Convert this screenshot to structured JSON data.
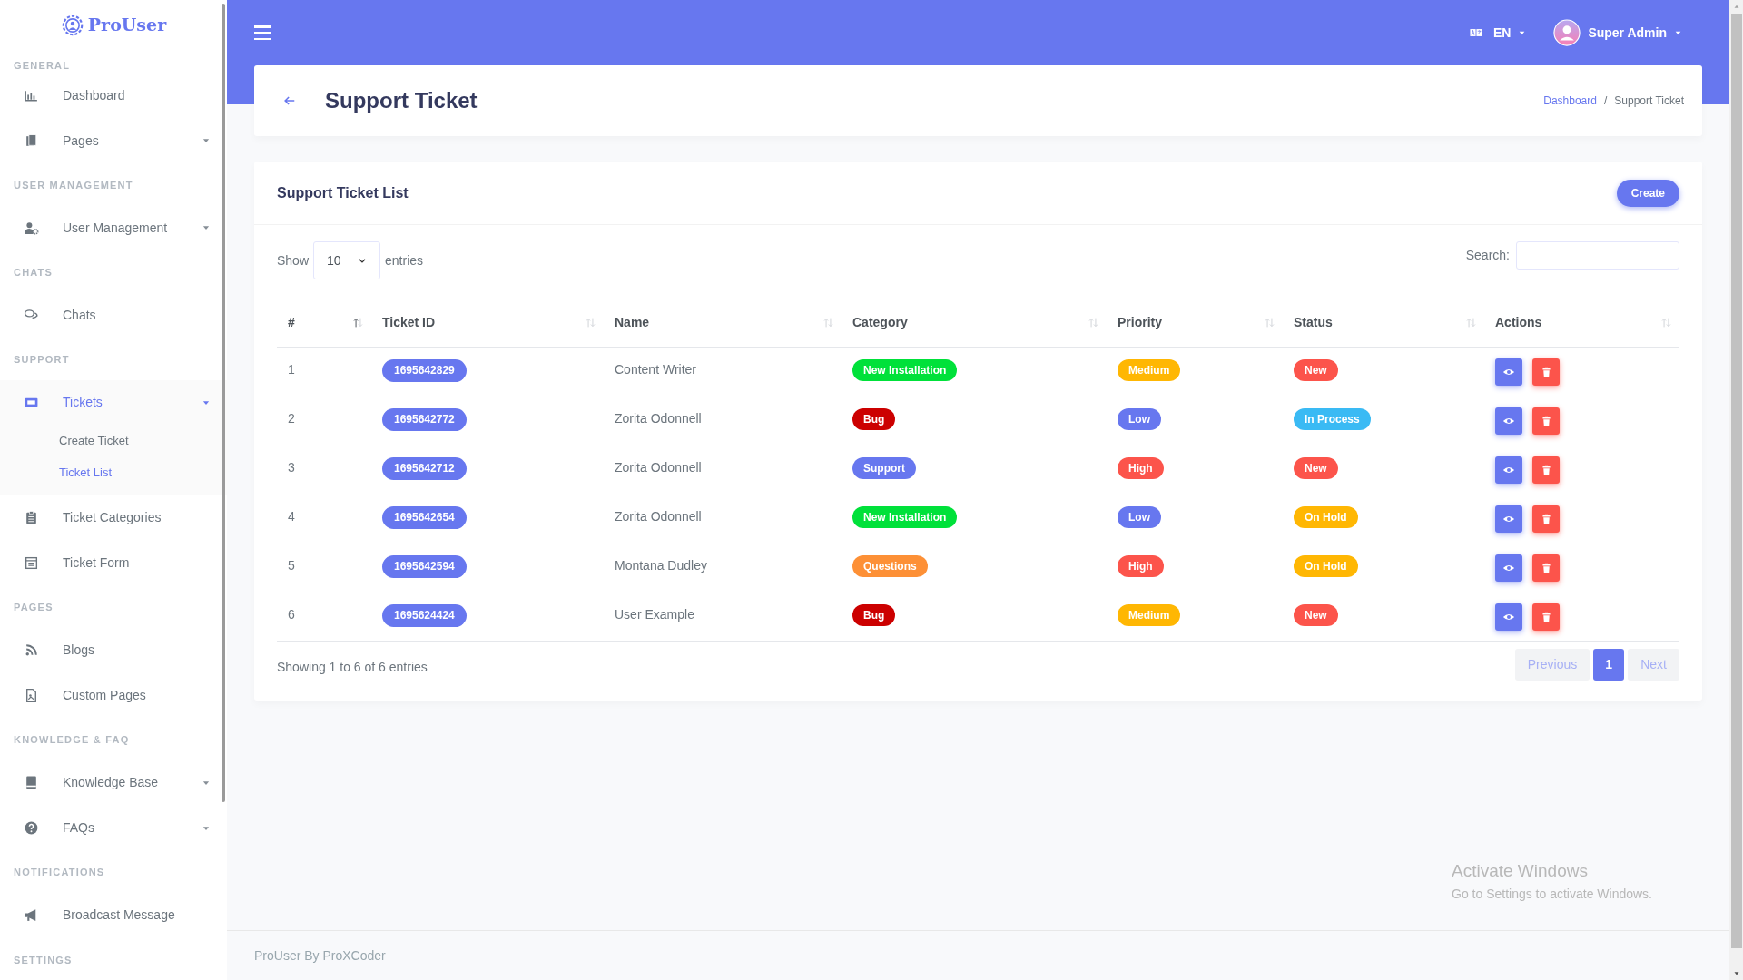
{
  "brand": {
    "name": "ProUser"
  },
  "sidebar": [
    {
      "kind": "header",
      "label": "GENERAL"
    },
    {
      "kind": "item",
      "label": "Dashboard",
      "dropdown": false,
      "selected": false
    },
    {
      "kind": "item",
      "label": "Pages",
      "dropdown": true,
      "selected": false
    },
    {
      "kind": "header",
      "label": "USER MANAGEMENT"
    },
    {
      "kind": "item",
      "label": "User Management",
      "dropdown": true,
      "selected": false
    },
    {
      "kind": "header",
      "label": "CHATS"
    },
    {
      "kind": "item",
      "label": "Chats",
      "dropdown": false,
      "selected": false
    },
    {
      "kind": "header",
      "label": "SUPPORT"
    },
    {
      "kind": "item",
      "label": "Tickets",
      "dropdown": true,
      "selected": true,
      "children": [
        {
          "label": "Create Ticket",
          "selected": false
        },
        {
          "label": "Ticket List",
          "selected": true
        }
      ]
    },
    {
      "kind": "item",
      "label": "Ticket Categories",
      "dropdown": false,
      "selected": false
    },
    {
      "kind": "item",
      "label": "Ticket Form",
      "dropdown": false,
      "selected": false
    },
    {
      "kind": "header",
      "label": "PAGES"
    },
    {
      "kind": "item",
      "label": "Blogs",
      "dropdown": false,
      "selected": false
    },
    {
      "kind": "item",
      "label": "Custom Pages",
      "dropdown": false,
      "selected": false
    },
    {
      "kind": "header",
      "label": "KNOWLEDGE & FAQ"
    },
    {
      "kind": "item",
      "label": "Knowledge Base",
      "dropdown": true,
      "selected": false
    },
    {
      "kind": "item",
      "label": "FAQs",
      "dropdown": true,
      "selected": false
    },
    {
      "kind": "header",
      "label": "NOTIFICATIONS"
    },
    {
      "kind": "item",
      "label": "Broadcast Message",
      "dropdown": false,
      "selected": false
    },
    {
      "kind": "header",
      "label": "SETTINGS"
    }
  ],
  "topbar": {
    "language": "EN",
    "user": "Super Admin"
  },
  "page_header": {
    "title": "Support Ticket",
    "breadcrumb_separator": "/",
    "breadcrumb": [
      {
        "label": "Dashboard",
        "link": true
      },
      {
        "label": "Support Ticket",
        "link": false
      }
    ]
  },
  "card": {
    "title": "Support Ticket List",
    "create_button": "Create",
    "length_control": {
      "before": "Show",
      "value": "10",
      "after": "entries"
    },
    "search": {
      "label": "Search:"
    },
    "columns": [
      {
        "label": "#",
        "sorted": true
      },
      {
        "label": "Ticket ID",
        "sorted": false
      },
      {
        "label": "Name",
        "sorted": false
      },
      {
        "label": "Category",
        "sorted": false
      },
      {
        "label": "Priority",
        "sorted": false
      },
      {
        "label": "Status",
        "sorted": false
      },
      {
        "label": "Actions",
        "sorted": false
      }
    ],
    "rows": [
      {
        "number": "1",
        "ticket_id": "1695642829",
        "name": "Content Writer",
        "category": {
          "label": "New Installation",
          "color": "#00e13a"
        },
        "priority": {
          "label": "Medium",
          "color": "#ffb703"
        },
        "status": {
          "label": "New",
          "color": "#fc544b"
        }
      },
      {
        "number": "2",
        "ticket_id": "1695642772",
        "name": "Zorita Odonnell",
        "category": {
          "label": "Bug",
          "color": "#cc0000"
        },
        "priority": {
          "label": "Low",
          "color": "#6777ef"
        },
        "status": {
          "label": "In Process",
          "color": "#3abaf4"
        }
      },
      {
        "number": "3",
        "ticket_id": "1695642712",
        "name": "Zorita Odonnell",
        "category": {
          "label": "Support",
          "color": "#6777ef"
        },
        "priority": {
          "label": "High",
          "color": "#fc544b"
        },
        "status": {
          "label": "New",
          "color": "#fc544b"
        }
      },
      {
        "number": "4",
        "ticket_id": "1695642654",
        "name": "Zorita Odonnell",
        "category": {
          "label": "New Installation",
          "color": "#00e13a"
        },
        "priority": {
          "label": "Low",
          "color": "#6777ef"
        },
        "status": {
          "label": "On Hold",
          "color": "#ffb703"
        }
      },
      {
        "number": "5",
        "ticket_id": "1695642594",
        "name": "Montana Dudley",
        "category": {
          "label": "Questions",
          "color": "#fd9036"
        },
        "priority": {
          "label": "High",
          "color": "#fc544b"
        },
        "status": {
          "label": "On Hold",
          "color": "#ffb703"
        }
      },
      {
        "number": "6",
        "ticket_id": "1695624424",
        "name": "User Example",
        "category": {
          "label": "Bug",
          "color": "#cc0000"
        },
        "priority": {
          "label": "Medium",
          "color": "#ffb703"
        },
        "status": {
          "label": "New",
          "color": "#fc544b"
        }
      }
    ],
    "info": "Showing 1 to 6 of 6 entries",
    "pagination": {
      "previous": {
        "label": "Previous",
        "disabled": true
      },
      "pages": [
        {
          "label": "1",
          "selected": true
        }
      ],
      "next": {
        "label": "Next",
        "disabled": true
      }
    }
  },
  "footer": "ProUser By ProXCoder",
  "os_overlay": {
    "title": "Activate Windows",
    "message": "Go to Settings to activate Windows."
  }
}
